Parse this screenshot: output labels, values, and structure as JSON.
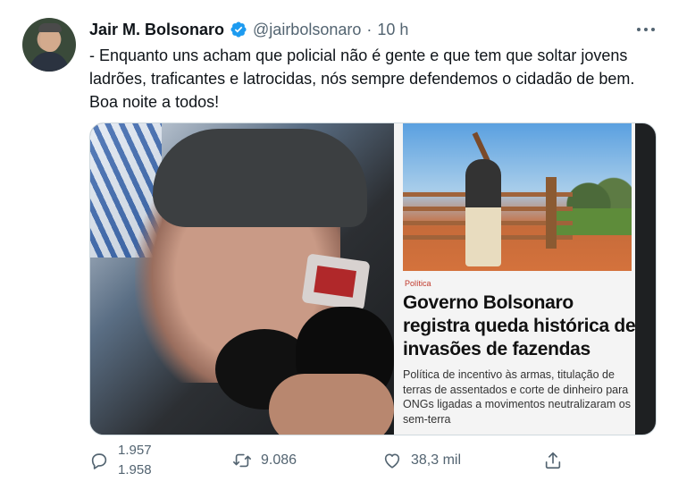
{
  "tweet": {
    "author_name": "Jair M. Bolsonaro",
    "handle": "@jairbolsonaro",
    "separator": "·",
    "time": "10 h",
    "text": "- Enquanto uns acham que policial não é gente e que tem que soltar jovens ladrões, traficantes e latrocidas, nós sempre defendemos o cidadão de bem. Boa noite a todos!"
  },
  "media": {
    "news_category": "Política",
    "news_headline": "Governo Bolsonaro registra queda histórica de invasões de fazendas",
    "news_subtitle": "Política de incentivo às armas, titulação de terras de assentados e corte de dinheiro para ONGs ligadas a movimentos neutralizaram os sem-terra"
  },
  "actions": {
    "reply_count_old": "1.957",
    "reply_count_new": "1.958",
    "retweet_count": "9.086",
    "like_count": "38,3 mil"
  },
  "icons": {
    "verified": "verified-badge-icon",
    "more": "more-options-icon",
    "reply": "reply-icon",
    "retweet": "retweet-icon",
    "like": "heart-icon",
    "share": "share-icon"
  },
  "colors": {
    "verified": "#1d9bf0",
    "secondary_text": "#536471",
    "category_red": "#c0392b"
  }
}
